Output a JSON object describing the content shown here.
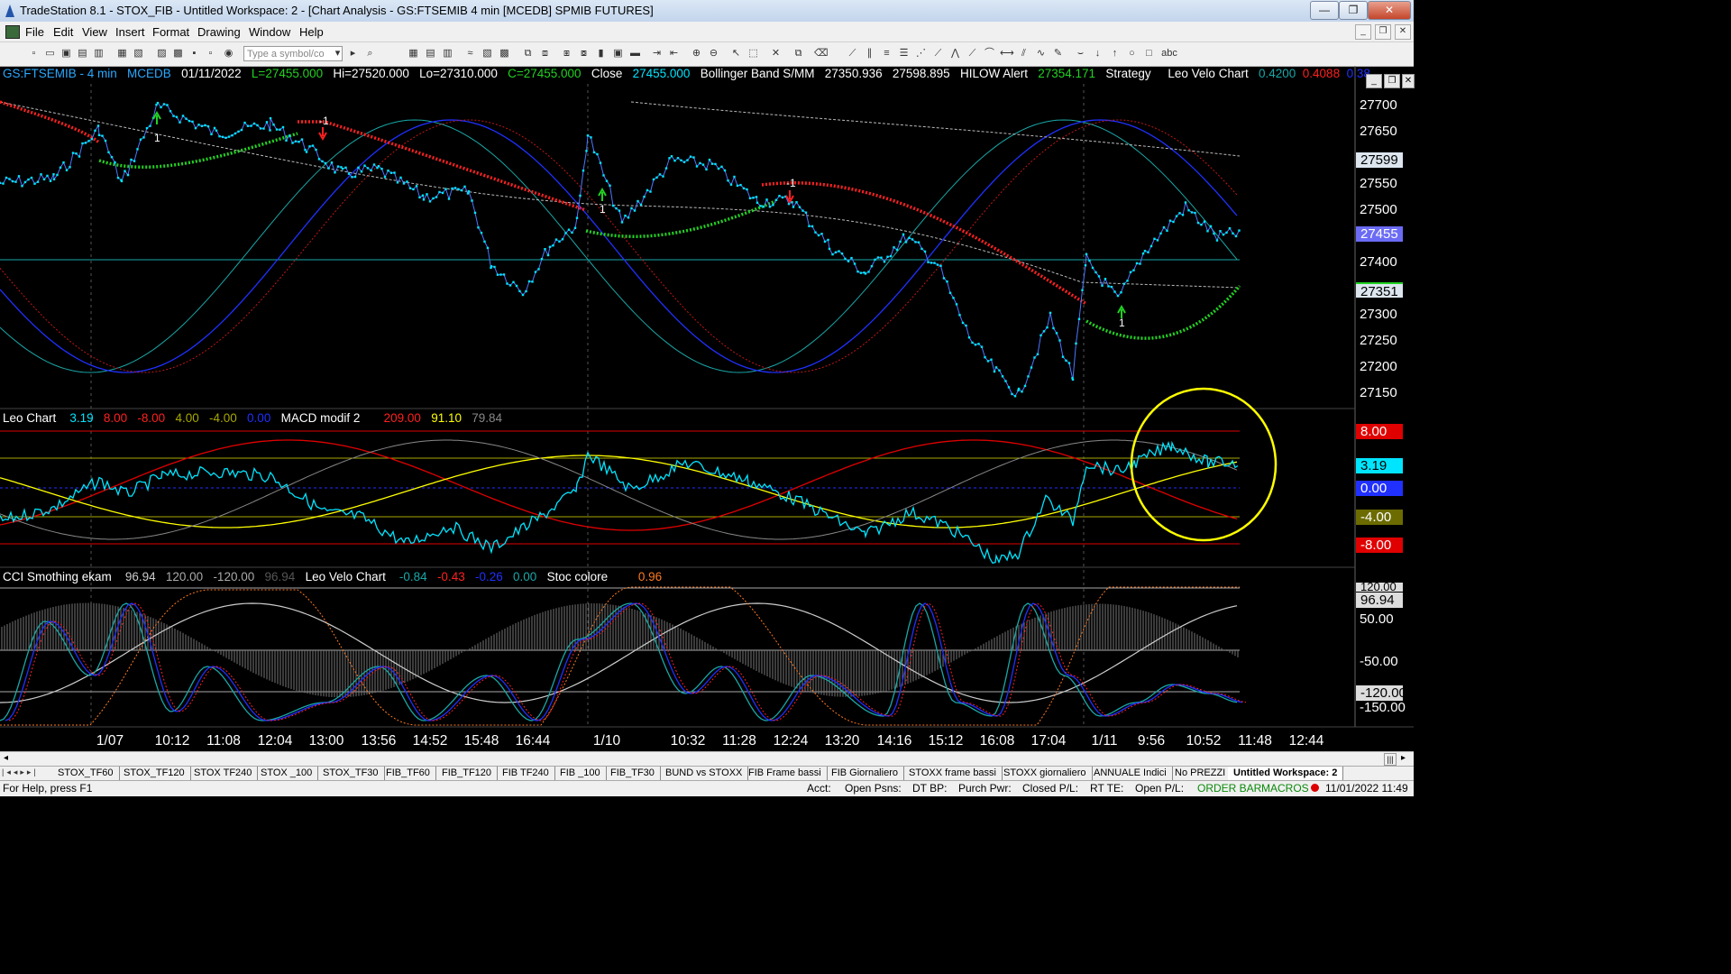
{
  "window": {
    "title": "TradeStation 8.1 - STOX_FIB - Untitled Workspace:  2 - [Chart Analysis - GS:FTSEMIB  4 min  [MCEDB] SPMIB FUTURES]",
    "min": "—",
    "restore": "❐",
    "close": "✕"
  },
  "menu": {
    "items": [
      "File",
      "Edit",
      "View",
      "Insert",
      "Format",
      "Drawing",
      "Window",
      "Help"
    ]
  },
  "toolbar": {
    "symbol_placeholder": "Type a symbol/co",
    "abc": "abc"
  },
  "colors": {
    "cyan": "#00e5ff",
    "green": "#22d122",
    "red": "#ff2020",
    "blue": "#2030ff",
    "yellow": "#ffff00",
    "teal": "#1aa7a7"
  },
  "price_pane": {
    "header": {
      "symbol": "GS:FTSEMIB - 4 min",
      "feed": "MCEDB",
      "date": "01/11/2022",
      "last": "L=27455.000",
      "hi": "Hi=27520.000",
      "lo": "Lo=27310.000",
      "close_value": "C=27455.000",
      "close_label": "Close",
      "close_num": "27455.000",
      "bb_label": "Bollinger Band S/MM",
      "bb1": "27350.936",
      "bb2": "27598.895",
      "hilow_label": "HILOW Alert",
      "hilow": "27354.171",
      "strategy": "Strategy",
      "velo": "Leo Velo Chart",
      "v1": "0.4200",
      "v2": "0.4088",
      "v3": "0.38..."
    },
    "axis_labels": [
      "27700",
      "27650",
      "27600",
      "27550",
      "27500",
      "27450",
      "27400",
      "27350",
      "27300",
      "27250",
      "27200",
      "27150"
    ],
    "marker_hi": "27599",
    "marker_last": "27455",
    "marker_lo": "27351",
    "signals": {
      "a": "1",
      "b": "-1",
      "c": "1",
      "d": "-1",
      "e": "1"
    }
  },
  "leo_pane": {
    "header": {
      "name": "Leo Chart",
      "v1": "3.19",
      "v2": "8.00",
      "v3": "-8.00",
      "v4": "4.00",
      "v5": "-4.00",
      "v6": "0.00",
      "macd": "MACD modif 2",
      "m1": "209.00",
      "m2": "91.10",
      "m3": "79.84"
    },
    "boxes": {
      "p8": "8.00",
      "cur": "3.19",
      "zero": "0.00",
      "m4": "-4.00",
      "m8": "-8.00"
    }
  },
  "cci_pane": {
    "header": {
      "name": "CCI Smothing ekam",
      "c1": "96.94",
      "c2": "120.00",
      "c3": "-120.00",
      "c4": "96.94",
      "velo": "Leo Velo Chart",
      "v1": "-0.84",
      "v2": "-0.43",
      "v3": "-0.26",
      "v4": "0.00",
      "stoc": "Stoc colore",
      "s1": "0.96"
    },
    "axis": {
      "a120": "120.00",
      "cur": "96.94",
      "a50": "50.00",
      "am50": "-50.00",
      "am120": "-120.00",
      "am150": "-150.00"
    }
  },
  "time_axis": [
    "1/07",
    "10:12",
    "11:08",
    "12:04",
    "13:00",
    "13:56",
    "14:52",
    "15:48",
    "16:44",
    "1/10",
    "10:32",
    "11:28",
    "12:24",
    "13:20",
    "14:16",
    "15:12",
    "16:08",
    "17:04",
    "1/11",
    "9:56",
    "10:52",
    "11:48",
    "12:44"
  ],
  "workspace_tabs": [
    "STOX_TF60",
    "STOX_TF120",
    "STOX TF240",
    "STOX _100",
    "STOX_TF30",
    "FIB_TF60",
    "FIB_TF120",
    "FIB TF240",
    "FIB _100",
    "FIB_TF30",
    "BUND vs STOXX",
    "FIB Frame bassi",
    "FIB Giornaliero",
    "STOXX frame bassi",
    "STOXX giornaliero",
    "ANNUALE Indici",
    "No PREZZI",
    "Untitled Workspace:  2"
  ],
  "status": {
    "help": "For Help, press F1",
    "acct": "Acct:",
    "open_psns": "Open Psns:",
    "dt_bp": "DT BP:",
    "purch_pwr": "Purch Pwr:",
    "closed_pl": "Closed P/L:",
    "rt_te": "RT TE:",
    "open_pl": "Open P/L:",
    "order_bar": "ORDER BAR",
    "macros": "MACROS",
    "datetime": "11/01/2022 11:49"
  }
}
